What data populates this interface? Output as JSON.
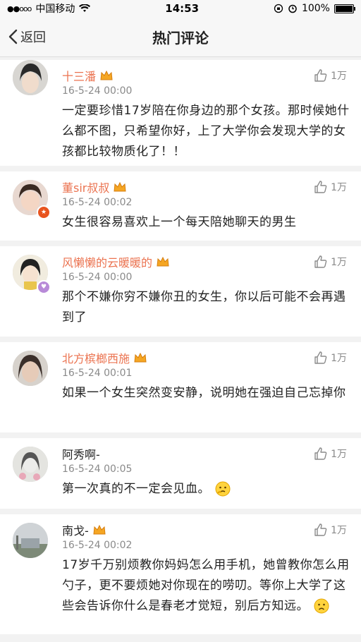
{
  "status_bar": {
    "signal": "●●ooo",
    "carrier": "中国移动",
    "time": "14:53",
    "battery": "100%"
  },
  "nav": {
    "back_label": "返回",
    "title": "热门评论"
  },
  "comments": [
    {
      "name": "十三潘",
      "vip": true,
      "likes": "1万",
      "time": "16-5-24 00:00",
      "text": "一定要珍惜17岁陪在你身边的那个女孩。那时候她什么都不图，只希望你好，上了大学你会发现大学的女孩都比较物质化了！！"
    },
    {
      "name": "董sir叔叔",
      "vip": true,
      "likes": "1万",
      "time": "16-5-24 00:02",
      "text": "女生很容易喜欢上一个每天陪她聊天的男生"
    },
    {
      "name": "风懒懒的云暖暖的",
      "vip": true,
      "likes": "1万",
      "time": "16-5-24 00:00",
      "text": "那个不嫌你穷不嫌你丑的女生，你以后可能不会再遇到了"
    },
    {
      "name": "北方槟榔西施",
      "vip": true,
      "likes": "1万",
      "time": "16-5-24 00:01",
      "text": "如果一个女生突然变安静，说明她在强迫自己忘掉你"
    },
    {
      "name": "阿秀啊-",
      "vip": false,
      "likes": "1万",
      "time": "16-5-24 00:05",
      "text": "第一次真的不一定会见血。"
    },
    {
      "name": "南戈-",
      "vip": false,
      "likes": "1万",
      "time": "16-5-24 00:02",
      "text": "17岁千万别烦教你妈妈怎么用手机，她曾教你怎么用勺子，更不要烦她对你现在的唠叨。等你上大学了这些会告诉你什么是春老才觉短，别后方知远。"
    }
  ]
}
